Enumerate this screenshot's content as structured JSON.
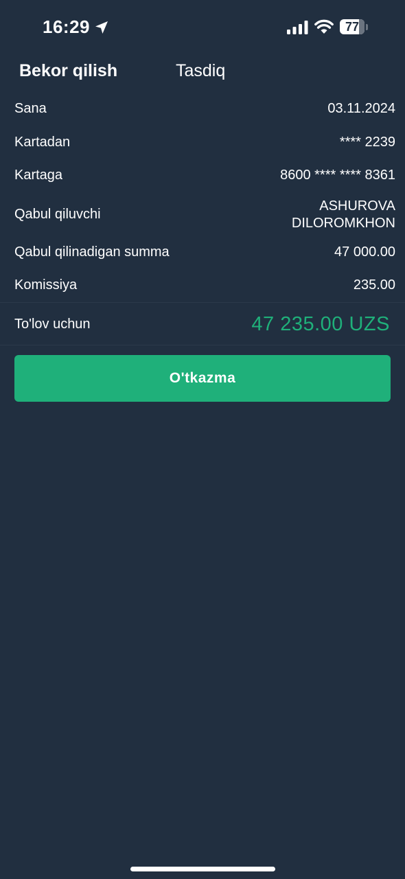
{
  "status_bar": {
    "time": "16:29",
    "battery": "77",
    "battery_level": 0.77
  },
  "header": {
    "cancel_label": "Bekor qilish",
    "confirm_label": "Tasdiq"
  },
  "details": {
    "date": {
      "label": "Sana",
      "value": "03.11.2024"
    },
    "from_card": {
      "label": "Kartadan",
      "value": "**** 2239"
    },
    "to_card": {
      "label": "Kartaga",
      "value": "8600 **** **** 8361"
    },
    "recipient": {
      "label": "Qabul qiluvchi",
      "value_line1": "ASHUROVA",
      "value_line2": "DILOROMKHON"
    },
    "received_amount": {
      "label": "Qabul qilinadigan summa",
      "value": "47 000.00"
    },
    "commission": {
      "label": "Komissiya",
      "value": "235.00"
    }
  },
  "total": {
    "label": "To'lov uchun",
    "value": "47 235.00 UZS"
  },
  "actions": {
    "transfer_label": "O'tkazma"
  },
  "colors": {
    "background": "#212f40",
    "accent": "#1fb07a",
    "text": "#ffffff"
  }
}
